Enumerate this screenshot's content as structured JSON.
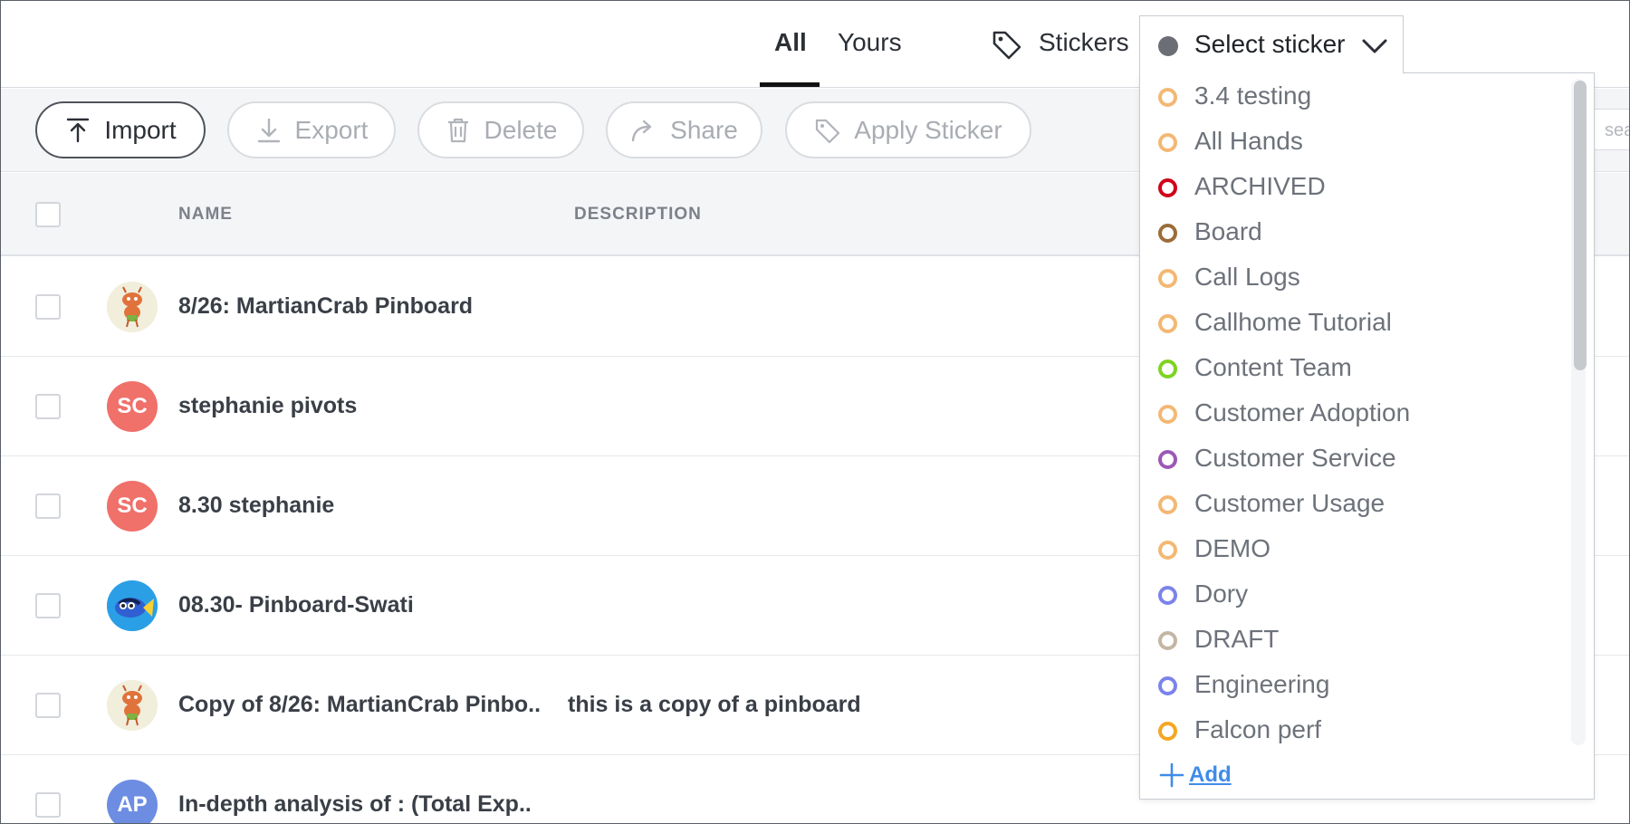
{
  "header": {
    "tabs": [
      {
        "label": "All",
        "active": true
      },
      {
        "label": "Yours",
        "active": false
      }
    ],
    "stickers_label": "Stickers",
    "select_sticker": {
      "label": "Select sticker",
      "dot_color": "#6b6f75"
    }
  },
  "toolbar": {
    "import_label": "Import",
    "export_label": "Export",
    "delete_label": "Delete",
    "share_label": "Share",
    "apply_sticker_label": "Apply Sticker",
    "search_placeholder": "sea"
  },
  "table": {
    "columns": [
      "NAME",
      "DESCRIPTION"
    ],
    "rows": [
      {
        "name": "8/26: MartianCrab Pinboard",
        "description": "",
        "avatar": "crab-avatar",
        "initials": ""
      },
      {
        "name": "stephanie pivots",
        "description": "",
        "avatar": "initials",
        "initials": "SC"
      },
      {
        "name": "8.30 stephanie",
        "description": "",
        "avatar": "initials",
        "initials": "SC"
      },
      {
        "name": "08.30- Pinboard-Swati",
        "description": "",
        "avatar": "fish-avatar",
        "initials": ""
      },
      {
        "name": "Copy of 8/26: MartianCrab Pinbo..",
        "description": "this is a copy of a pinboard",
        "avatar": "crab-avatar",
        "initials": ""
      },
      {
        "name": "In-depth analysis of : (Total Exp..",
        "description": "",
        "avatar": "initials",
        "initials": "AP"
      }
    ]
  },
  "dropdown": {
    "items": [
      {
        "label": "3.4 testing",
        "color": "#f3b874"
      },
      {
        "label": "All Hands",
        "color": "#f3b874"
      },
      {
        "label": "ARCHIVED",
        "color": "#d0021b"
      },
      {
        "label": "Board",
        "color": "#9b6d3a"
      },
      {
        "label": "Call Logs",
        "color": "#f3b874"
      },
      {
        "label": "Callhome Tutorial",
        "color": "#f3b874"
      },
      {
        "label": "Content Team",
        "color": "#7ed321"
      },
      {
        "label": "Customer Adoption",
        "color": "#f3b874"
      },
      {
        "label": "Customer Service",
        "color": "#9b59b6"
      },
      {
        "label": "Customer Usage",
        "color": "#f3b874"
      },
      {
        "label": "DEMO",
        "color": "#f3b874"
      },
      {
        "label": "Dory",
        "color": "#7b83eb"
      },
      {
        "label": "DRAFT",
        "color": "#c4b5a5"
      },
      {
        "label": "Engineering",
        "color": "#7b83eb"
      },
      {
        "label": "Falcon perf",
        "color": "#f5a623"
      }
    ],
    "add_label": "Add",
    "add_color": "#3f8ce8"
  }
}
